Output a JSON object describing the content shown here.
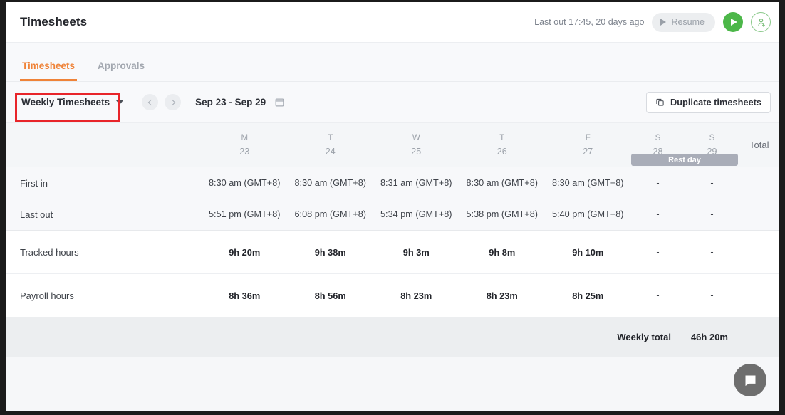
{
  "header": {
    "title": "Timesheets",
    "last_out": "Last out 17:45, 20 days ago",
    "resume_label": "Resume",
    "play_icon": "play-icon",
    "avatar_icon": "user-avatar-icon"
  },
  "tabs": [
    {
      "label": "Timesheets",
      "active": true
    },
    {
      "label": "Approvals",
      "active": false
    }
  ],
  "toolbar": {
    "view_select": "Weekly Timesheets",
    "prev_icon": "chevron-left-icon",
    "next_icon": "chevron-right-icon",
    "date_range": "Sep 23 - Sep 29",
    "calendar_icon": "calendar-icon",
    "duplicate_label": "Duplicate timesheets",
    "duplicate_icon": "copy-icon"
  },
  "table": {
    "days": [
      {
        "dow": "M",
        "date": "23"
      },
      {
        "dow": "T",
        "date": "24"
      },
      {
        "dow": "W",
        "date": "25"
      },
      {
        "dow": "T",
        "date": "26"
      },
      {
        "dow": "F",
        "date": "27"
      },
      {
        "dow": "S",
        "date": "28"
      },
      {
        "dow": "S",
        "date": "29"
      }
    ],
    "rest_day_badge": "Rest day",
    "total_header": "Total",
    "rows": [
      {
        "label": "First in",
        "values": [
          "8:30 am (GMT+8)",
          "8:30 am (GMT+8)",
          "8:31 am (GMT+8)",
          "8:30 am (GMT+8)",
          "8:30 am (GMT+8)",
          "-",
          "-"
        ],
        "total": ""
      },
      {
        "label": "Last out",
        "values": [
          "5:51 pm (GMT+8)",
          "6:08 pm (GMT+8)",
          "5:34 pm (GMT+8)",
          "5:38 pm (GMT+8)",
          "5:40 pm (GMT+8)",
          "-",
          "-"
        ],
        "total": ""
      },
      {
        "label": "Tracked hours",
        "values": [
          "9h 20m",
          "9h 38m",
          "9h 3m",
          "9h 8m",
          "9h 10m",
          "-",
          "-"
        ],
        "total": ""
      },
      {
        "label": "Payroll hours",
        "values": [
          "8h 36m",
          "8h 56m",
          "8h 23m",
          "8h 23m",
          "8h 25m",
          "-",
          "-"
        ],
        "total": ""
      }
    ],
    "weekly_total_label": "Weekly total",
    "weekly_total_value": "46h 20m"
  },
  "chat": {
    "icon": "chat-bubble-icon"
  },
  "colors": {
    "accent": "#ef8338",
    "green": "#4cb749",
    "annotation": "#e8252a",
    "rest_day": "#a9adb8"
  }
}
